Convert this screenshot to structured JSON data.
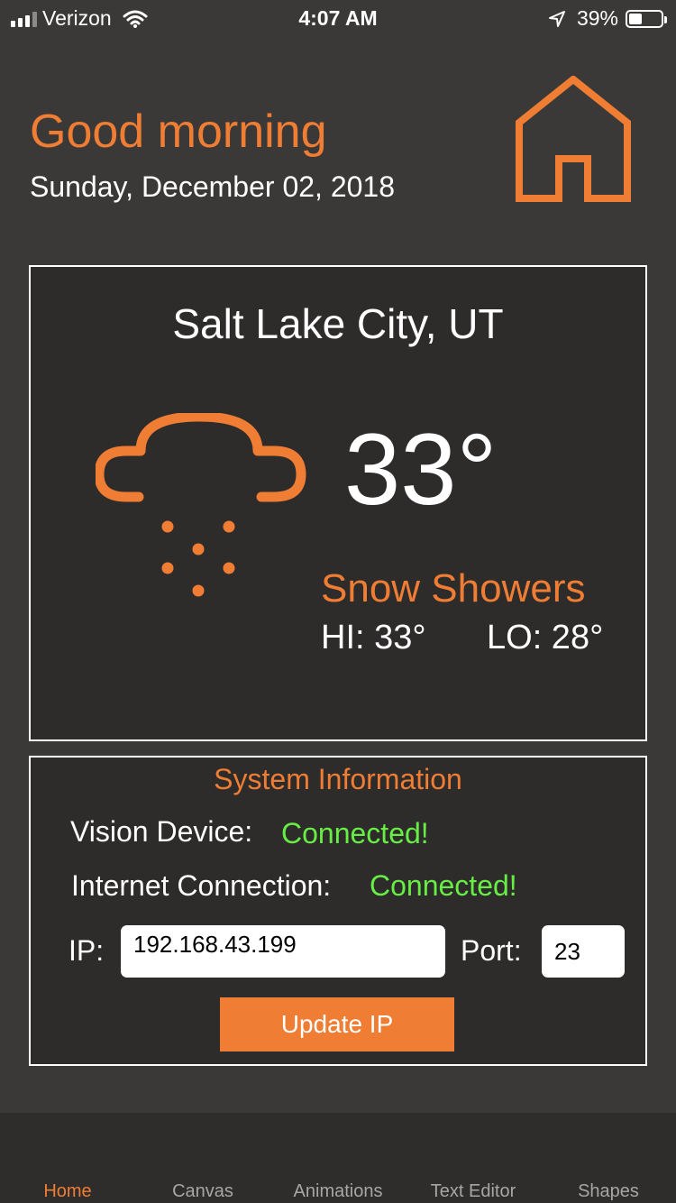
{
  "status_bar": {
    "carrier": "Verizon",
    "time": "4:07 AM",
    "battery": "39%",
    "battery_level": 0.39
  },
  "header": {
    "greeting": "Good morning",
    "date": "Sunday, December 02, 2018",
    "icon": "home-icon"
  },
  "weather": {
    "city": "Salt Lake City,  UT",
    "temperature": "33°",
    "condition": "Snow Showers",
    "hi": "HI: 33°",
    "lo": "LO: 28°",
    "icon": "snow-cloud-icon"
  },
  "system": {
    "title": "System Information",
    "vision_label": "Vision Device:",
    "vision_value": "Connected!",
    "internet_label": "Internet Connection:",
    "internet_value": "Connected!",
    "ip_label": "IP:",
    "ip_value": "192.168.43.199",
    "port_label": "Port:",
    "port_value": "23",
    "update_label": "Update IP"
  },
  "tabs": [
    {
      "label": "Home",
      "active": true
    },
    {
      "label": "Canvas",
      "active": false
    },
    {
      "label": "Animations",
      "active": false
    },
    {
      "label": "Text Editor",
      "active": false
    },
    {
      "label": "Shapes",
      "active": false
    }
  ],
  "colors": {
    "accent": "#ef7d34",
    "background": "#3b3938",
    "card": "#2e2b2b",
    "status_ok": "#66ee44"
  }
}
